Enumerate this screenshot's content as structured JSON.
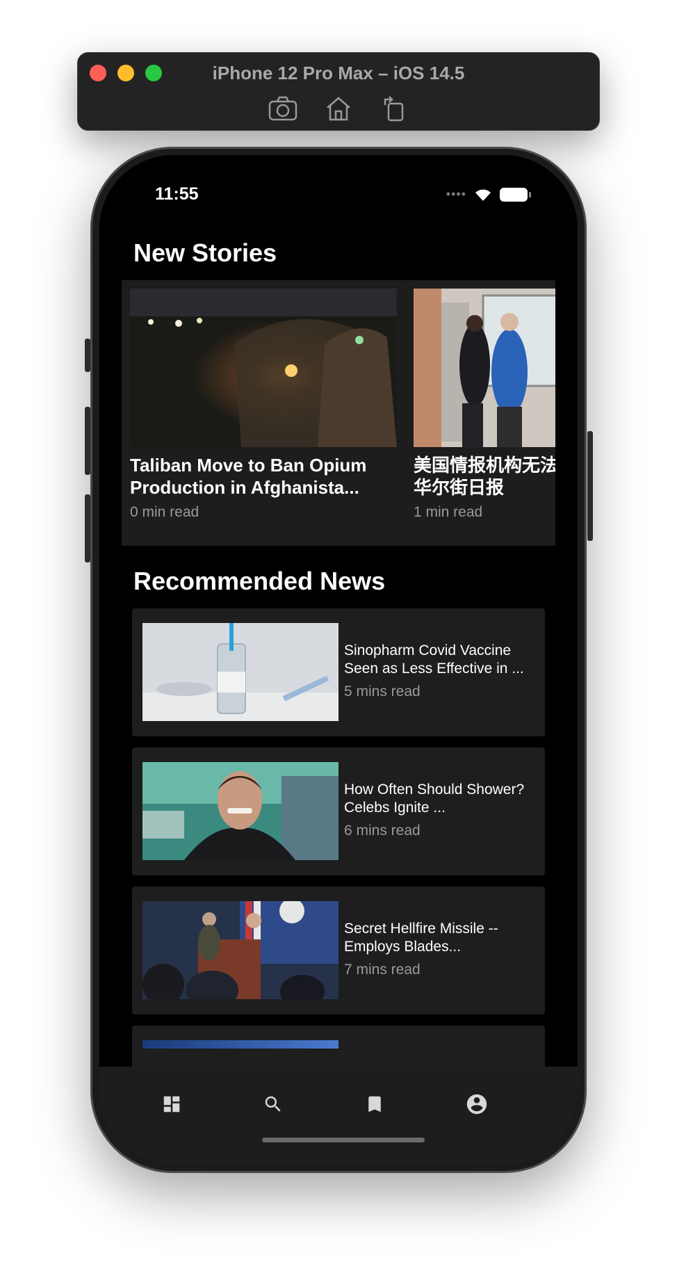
{
  "simulator": {
    "title": "iPhone 12 Pro Max – iOS 14.5",
    "tools": [
      "camera-icon",
      "home-icon",
      "rotate-icon"
    ]
  },
  "status": {
    "time": "11:55"
  },
  "sections": {
    "new_stories": "New Stories",
    "recommended": "Recommended News"
  },
  "stories": [
    {
      "title": "Taliban Move to Ban Opium Production in Afghanista...",
      "meta": "0 min read"
    },
    {
      "title": "美国情报机构无法确定病毒起源 - 华尔街日报",
      "meta": "1 min read"
    }
  ],
  "news": [
    {
      "title": "Sinopharm Covid Vaccine Seen as Less Effective in ...",
      "meta": "5 mins read"
    },
    {
      "title": "How Often Should Shower? Celebs Ignite ...",
      "meta": "6 mins read"
    },
    {
      "title": "Secret Hellfire Missile -- Employs Blades...",
      "meta": "7 mins read"
    }
  ],
  "tabs": [
    "dashboard-icon",
    "search-icon",
    "bookmark-icon",
    "account-icon"
  ],
  "colors": {
    "screen_bg": "#000000",
    "card_bg": "#1e1e1e",
    "text_primary": "#ffffff",
    "text_secondary": "#9a9a9a"
  }
}
